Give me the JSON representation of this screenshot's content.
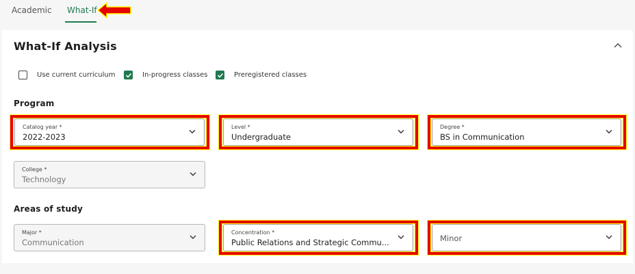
{
  "tabs": [
    {
      "label": "Academic",
      "active": false
    },
    {
      "label": "What-If",
      "active": true
    }
  ],
  "panel": {
    "title": "What-If Analysis",
    "collapse_icon": "chevron-up-icon"
  },
  "options": [
    {
      "label": "Use current curriculum",
      "checked": false
    },
    {
      "label": "In-progress classes",
      "checked": true
    },
    {
      "label": "Preregistered classes",
      "checked": true
    }
  ],
  "program": {
    "section_title": "Program",
    "catalog_year": {
      "label": "Catalog year *",
      "value": "2022-2023"
    },
    "level": {
      "label": "Level *",
      "value": "Undergraduate"
    },
    "degree": {
      "label": "Degree *",
      "value": "BS in Communication"
    },
    "college": {
      "label": "College *",
      "value": "Technology"
    }
  },
  "areas": {
    "section_title": "Areas of study",
    "major": {
      "label": "Major *",
      "value": "Communication"
    },
    "concentration": {
      "label": "Concentration *",
      "value": "Public Relations and Strategic Commu..."
    },
    "minor": {
      "placeholder": "Minor"
    }
  },
  "colors": {
    "accent": "#1f7a4f",
    "highlight": "#e60000"
  }
}
